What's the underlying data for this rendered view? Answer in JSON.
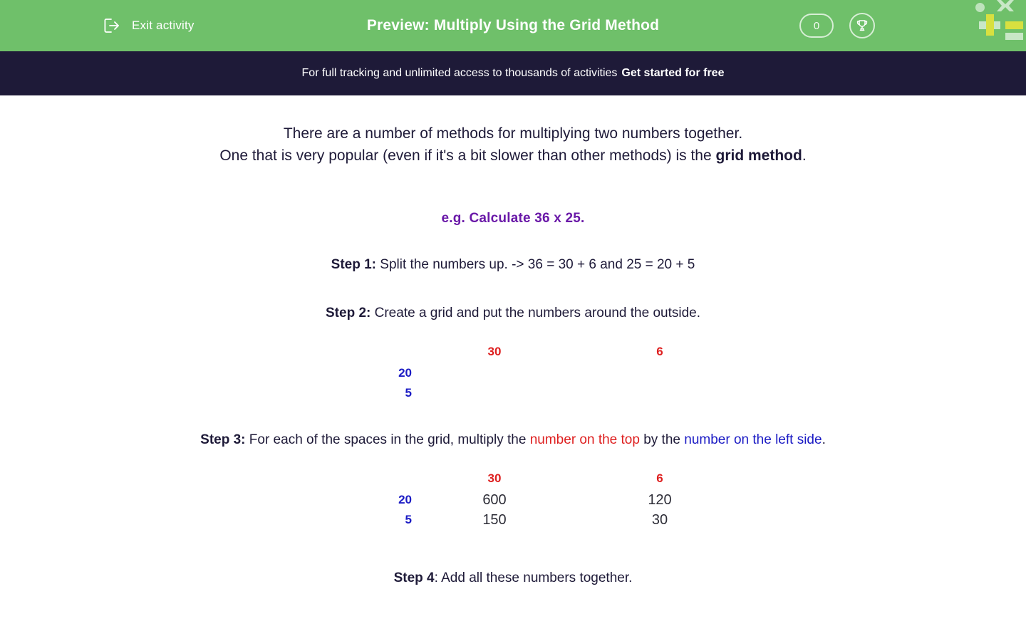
{
  "header": {
    "exit_label": "Exit activity",
    "exit_icon": "exit-door-arrow-icon",
    "title": "Preview: Multiply Using the Grid Method",
    "score_value": "0",
    "trophy_icon": "trophy-icon",
    "bg_color": "#6fc06a"
  },
  "promo": {
    "message": "For full tracking and unlimited access to thousands of activities",
    "cta": "Get started for free",
    "bg_color": "#1e1a38"
  },
  "activity": {
    "intro_line1": "There are a number of methods for multiplying two numbers together.",
    "intro_line2_before": "One that is very popular (even if it's a bit slower than other methods) is the ",
    "intro_line2_bold": "grid method",
    "intro_line2_after": ".",
    "example_heading": "e.g. Calculate 36 x 25.",
    "example_heading_color": "#6a19a8",
    "step1_label": "Step 1:",
    "step1_text": " Split the numbers up.  ->  36 = 30 + 6 and 25 = 20 + 5",
    "step2_label": "Step 2:",
    "step2_text": " Create a grid and put the numbers around the outside.",
    "step3_label": "Step 3:",
    "step3_text_a": " For each of the spaces in the grid, multiply the ",
    "step3_red": "number on the top",
    "step3_text_b": " by the ",
    "step3_blue": "number on the left side",
    "step3_text_c": ".",
    "step4_label": "Step 4",
    "step4_text": ": Add all these numbers together.",
    "red_color": "#de1f1f",
    "blue_color": "#1a1ac4"
  },
  "grid_empty": {
    "top_headers": [
      "30",
      "6"
    ],
    "side_headers": [
      "20",
      "5"
    ],
    "rows": [
      [
        "",
        ""
      ],
      [
        "",
        ""
      ]
    ]
  },
  "grid_filled": {
    "top_headers": [
      "30",
      "6"
    ],
    "side_headers": [
      "20",
      "5"
    ],
    "rows": [
      [
        "600",
        "120"
      ],
      [
        "150",
        "30"
      ]
    ]
  }
}
